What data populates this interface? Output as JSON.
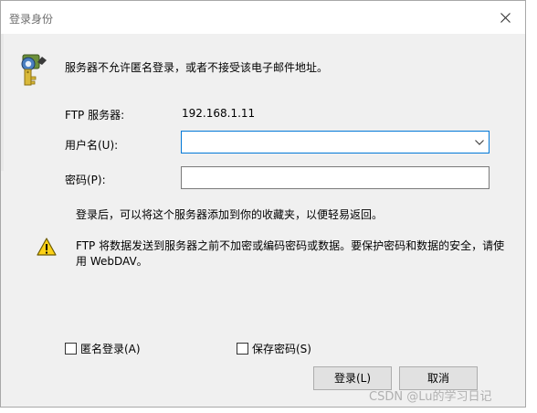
{
  "window": {
    "title": "登录身份"
  },
  "message": {
    "info": "服务器不允许匿名登录，或者不接受该电子邮件地址。"
  },
  "ftp": {
    "label": "FTP 服务器:",
    "value": "192.168.1.11"
  },
  "username": {
    "label": "用户名(U):",
    "value": ""
  },
  "password": {
    "label": "密码(P):",
    "value": ""
  },
  "note": "登录后，可以将这个服务器添加到你的收藏夹，以便轻易返回。",
  "warning": "FTP 将数据发送到服务器之前不加密或编码密码或数据。要保护密码和数据的安全，请使用 WebDAV。",
  "options": {
    "anonymous_label": "匿名登录(A)",
    "anonymous_checked": false,
    "save_password_label": "保存密码(S)",
    "save_password_checked": false
  },
  "buttons": {
    "login": "登录(L)",
    "cancel": "取消"
  },
  "watermark": "CSDN @Lu的学习日记",
  "icons": {
    "close": "close-icon",
    "key": "key-icon",
    "warning": "warning-icon",
    "dropdown": "chevron-down-icon"
  },
  "colors": {
    "accent": "#0078d7",
    "dialog_bg": "#f0f0f0",
    "button_bg": "#e1e1e1"
  }
}
